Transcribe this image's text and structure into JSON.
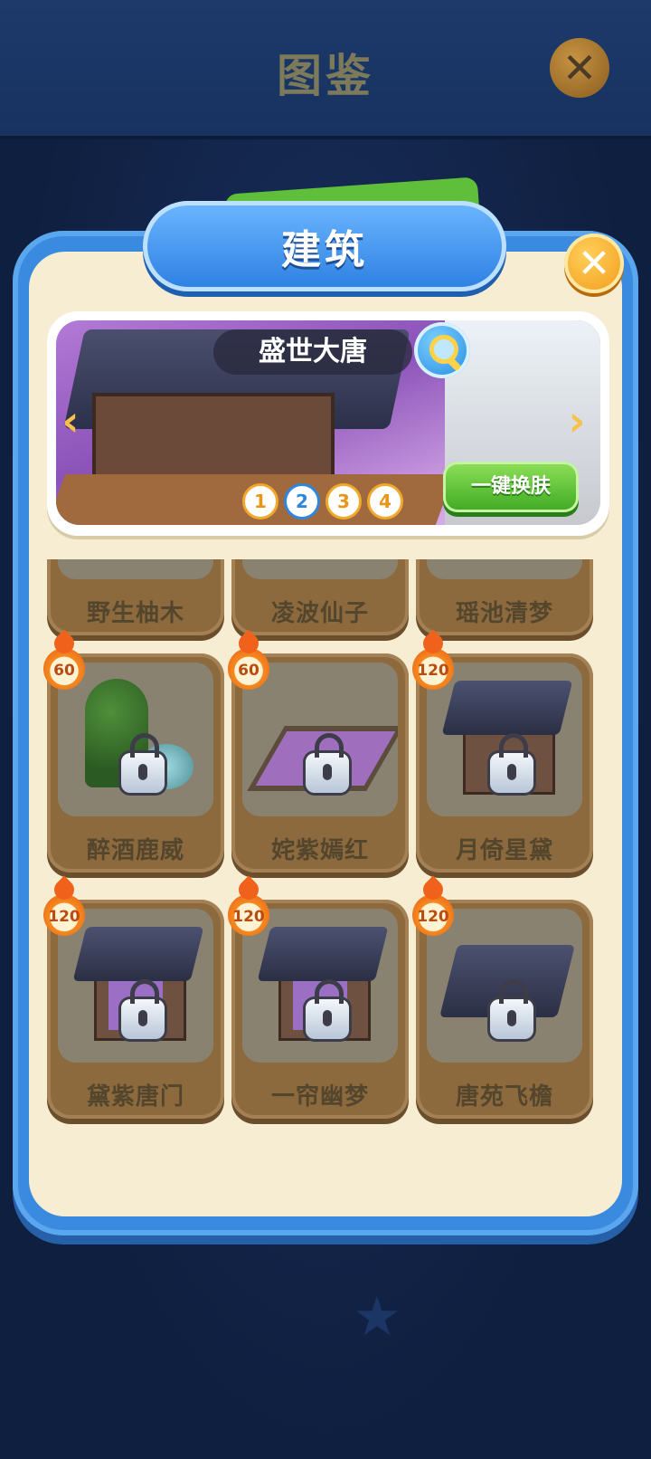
{
  "header": {
    "title": "图鉴",
    "close_icon": "close-icon"
  },
  "panel": {
    "title": "建筑",
    "close_icon": "close-icon"
  },
  "banner": {
    "set_name": "盛世大唐",
    "search_icon": "magnifier-icon",
    "pages": [
      "1",
      "2",
      "3",
      "4"
    ],
    "active_page": "2",
    "skin_button": "一键换肤"
  },
  "items": [
    {
      "label": "野生柚木",
      "badge": "",
      "locked": true,
      "thumb": "partial"
    },
    {
      "label": "凌波仙子",
      "badge": "",
      "locked": true,
      "thumb": "partial"
    },
    {
      "label": "瑶池清梦",
      "badge": "",
      "locked": true,
      "thumb": "partial"
    },
    {
      "label": "醉酒鹿威",
      "badge": "60",
      "locked": true,
      "thumb": "bamboo-fountain"
    },
    {
      "label": "姹紫嫣红",
      "badge": "60",
      "locked": true,
      "thumb": "carpet"
    },
    {
      "label": "月倚星黛",
      "badge": "120",
      "locked": true,
      "thumb": "pavilion"
    },
    {
      "label": "黛紫唐门",
      "badge": "120",
      "locked": true,
      "thumb": "gate"
    },
    {
      "label": "一帘幽梦",
      "badge": "120",
      "locked": true,
      "thumb": "pavilion"
    },
    {
      "label": "唐苑飞檐",
      "badge": "120",
      "locked": true,
      "thumb": "roof"
    }
  ],
  "colors": {
    "panel_blue": "#3a8be0",
    "cream": "#f7edd2",
    "card_brown": "#8c6a3e",
    "accent_orange": "#f29a18",
    "green_button": "#3ea922"
  }
}
